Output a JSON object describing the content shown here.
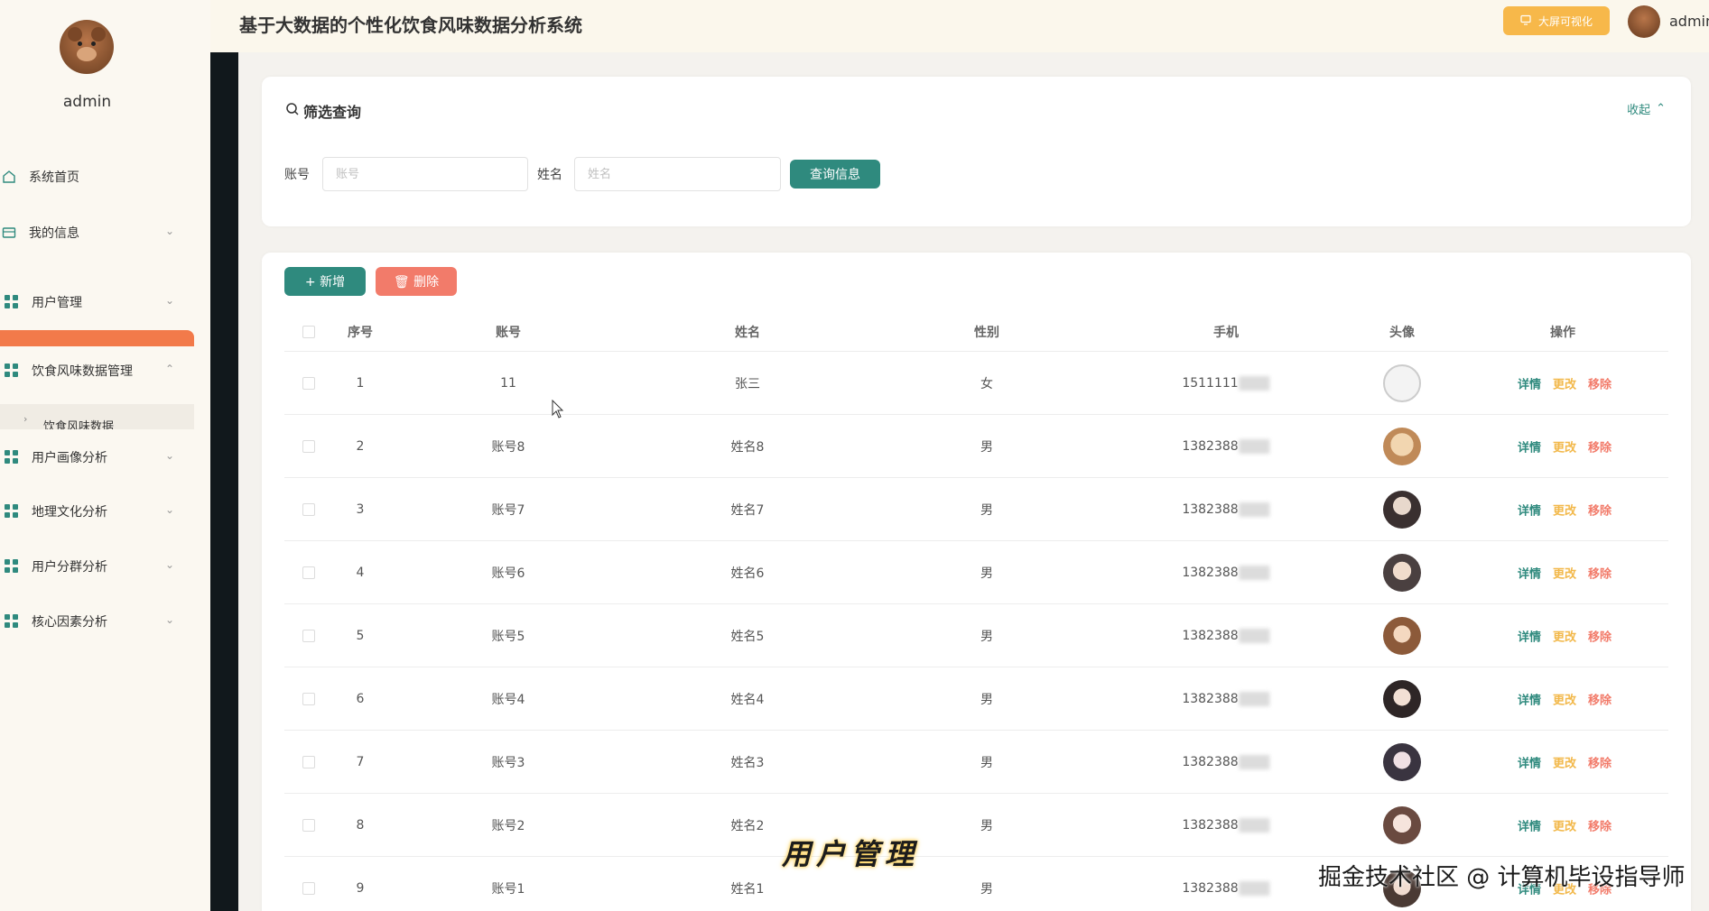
{
  "header": {
    "title": "基于大数据的个性化饮食风味数据分析系统",
    "viz_button": "大屏可视化",
    "username": "admin"
  },
  "sidebar": {
    "username": "admin",
    "items": [
      {
        "label": "系统首页"
      },
      {
        "label": "我的信息"
      },
      {
        "label": "用户管理"
      },
      {
        "label": "饮食风味数据管理"
      },
      {
        "label": "用户画像分析"
      },
      {
        "label": "地理文化分析"
      },
      {
        "label": "用户分群分析"
      },
      {
        "label": "核心因素分析"
      }
    ],
    "sub_item": "饮食风味数据"
  },
  "filter": {
    "title": "筛选查询",
    "collapse_label": "收起",
    "account_label": "账号",
    "account_placeholder": "账号",
    "name_label": "姓名",
    "name_placeholder": "姓名",
    "query_button": "查询信息"
  },
  "toolbar": {
    "add_button": "+ 新增",
    "delete_button": "删除"
  },
  "table": {
    "columns": [
      "序号",
      "账号",
      "姓名",
      "性别",
      "手机",
      "头像",
      "操作"
    ],
    "actions": {
      "detail": "详情",
      "edit": "更改",
      "remove": "移除"
    },
    "rows": [
      {
        "index": "1",
        "account": "11",
        "name": "张三",
        "gender": "女",
        "phone": "1511111"
      },
      {
        "index": "2",
        "account": "账号8",
        "name": "姓名8",
        "gender": "男",
        "phone": "1382388"
      },
      {
        "index": "3",
        "account": "账号7",
        "name": "姓名7",
        "gender": "男",
        "phone": "1382388"
      },
      {
        "index": "4",
        "account": "账号6",
        "name": "姓名6",
        "gender": "男",
        "phone": "1382388"
      },
      {
        "index": "5",
        "account": "账号5",
        "name": "姓名5",
        "gender": "男",
        "phone": "1382388"
      },
      {
        "index": "6",
        "account": "账号4",
        "name": "姓名4",
        "gender": "男",
        "phone": "1382388"
      },
      {
        "index": "7",
        "account": "账号3",
        "name": "姓名3",
        "gender": "男",
        "phone": "1382388"
      },
      {
        "index": "8",
        "account": "账号2",
        "name": "姓名2",
        "gender": "男",
        "phone": "1382388"
      },
      {
        "index": "9",
        "account": "账号1",
        "name": "姓名1",
        "gender": "男",
        "phone": "1382388"
      }
    ]
  },
  "overlay": {
    "caption": "用户管理",
    "watermark": "掘金技术社区 @ 计算机毕设指导师"
  },
  "colors": {
    "primary": "#2f8a7e",
    "danger": "#f27b6a",
    "warning": "#f2b84a",
    "active": "#f27a4a"
  }
}
